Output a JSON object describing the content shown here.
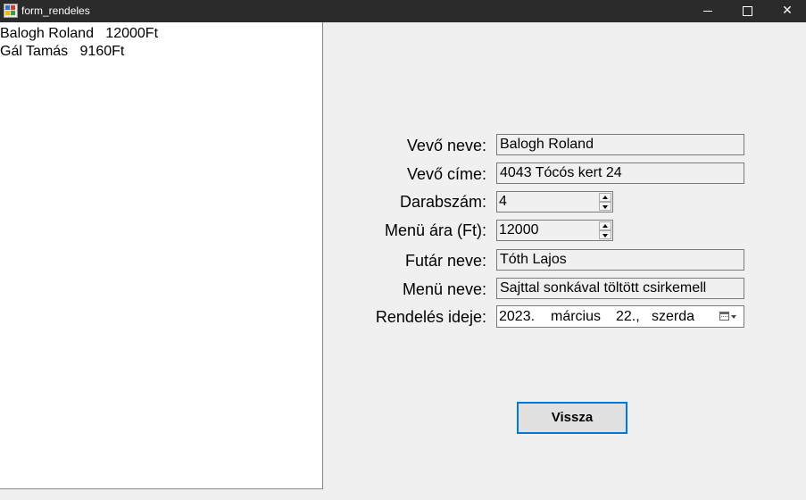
{
  "window": {
    "title": "form_rendeles",
    "controls": {
      "minimize": "minimize-icon",
      "maximize": "maximize-icon",
      "close": "close-icon"
    }
  },
  "list": {
    "items": [
      "Balogh Roland   12000Ft",
      "Gál Tamás   9160Ft"
    ]
  },
  "form": {
    "vevo_neve": {
      "label": "Vevő neve:",
      "value": "Balogh Roland"
    },
    "vevo_cime": {
      "label": "Vevő címe:",
      "value": "4043 Tócós kert 24"
    },
    "darabszam": {
      "label": "Darabszám:",
      "value": "4"
    },
    "menu_ara": {
      "label": "Menü ára (Ft):",
      "value": "12000"
    },
    "futar_neve": {
      "label": "Futár neve:",
      "value": "Tóth Lajos"
    },
    "menu_neve": {
      "label": "Menü neve:",
      "value": "Sajttal sonkával töltött csirkemell"
    },
    "rendeles_ideje": {
      "label": "Rendelés ideje:",
      "year": "2023.",
      "month": "március",
      "day": "22.,",
      "weekday": "szerda"
    }
  },
  "buttons": {
    "back_label": "Vissza"
  },
  "colors": {
    "titlebar": "#2b2b2b",
    "accent": "#0078d7",
    "background": "#f0f0f0"
  }
}
